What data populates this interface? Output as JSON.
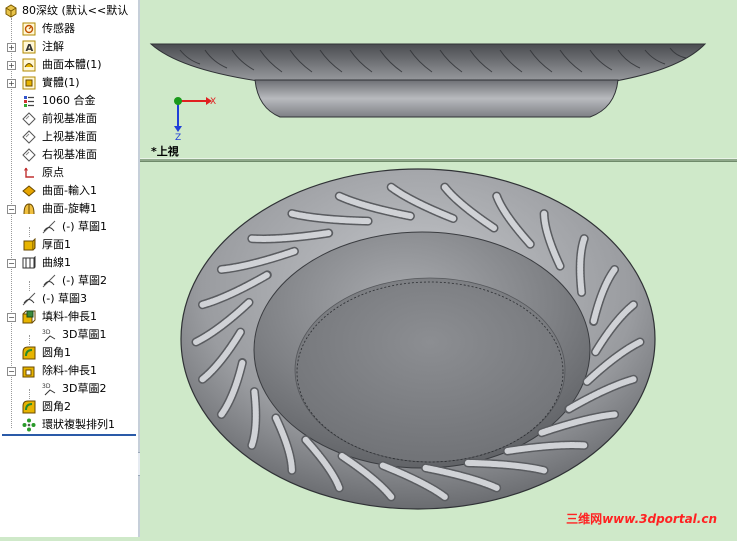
{
  "feature_tree": {
    "part_name": "80深纹  (默认<<默认",
    "items": [
      {
        "label": "传感器",
        "icon": "sensor-icon"
      },
      {
        "label": "注解",
        "icon": "annotation-icon"
      },
      {
        "label": "曲面本體(1)",
        "icon": "surface-bodies-icon"
      },
      {
        "label": "實體(1)",
        "icon": "solid-bodies-icon"
      },
      {
        "label": "1060 合金",
        "icon": "material-icon"
      },
      {
        "label": "前视基准面",
        "icon": "plane-icon"
      },
      {
        "label": "上视基准面",
        "icon": "plane-icon"
      },
      {
        "label": "右视基准面",
        "icon": "plane-icon"
      },
      {
        "label": "原点",
        "icon": "origin-icon"
      },
      {
        "label": "曲面-輸入1",
        "icon": "imported-surface-icon"
      },
      {
        "label": "曲面-旋轉1",
        "icon": "revolved-surface-icon"
      },
      {
        "label": "(-) 草圖1",
        "icon": "sketch-icon"
      },
      {
        "label": "厚面1",
        "icon": "thicken-icon"
      },
      {
        "label": "曲線1",
        "icon": "curve-icon"
      },
      {
        "label": "(-) 草圖2",
        "icon": "sketch-icon"
      },
      {
        "label": "(-) 草圖3",
        "icon": "sketch-icon"
      },
      {
        "label": "填料-伸長1",
        "icon": "extrude-boss-icon"
      },
      {
        "label": "3D草圖1",
        "icon": "3d-sketch-icon"
      },
      {
        "label": "圆角1",
        "icon": "fillet-icon"
      },
      {
        "label": "除料-伸長1",
        "icon": "extrude-cut-icon"
      },
      {
        "label": "3D草圖2",
        "icon": "3d-sketch-icon"
      },
      {
        "label": "圆角2",
        "icon": "fillet-icon"
      },
      {
        "label": "環狀複製排列1",
        "icon": "circular-pattern-icon"
      }
    ]
  },
  "viewport": {
    "top_view_label": "*上視",
    "triad": {
      "x_label": "X",
      "z_label": "Z",
      "x_color": "#e02020",
      "z_color": "#1f3fd8",
      "y_color": "#1a9a1a"
    },
    "background_color": "#cfe9c9",
    "model_color": "#8e9094"
  },
  "watermark": {
    "brand": "三维网",
    "url": "www.3dportal.cn"
  }
}
